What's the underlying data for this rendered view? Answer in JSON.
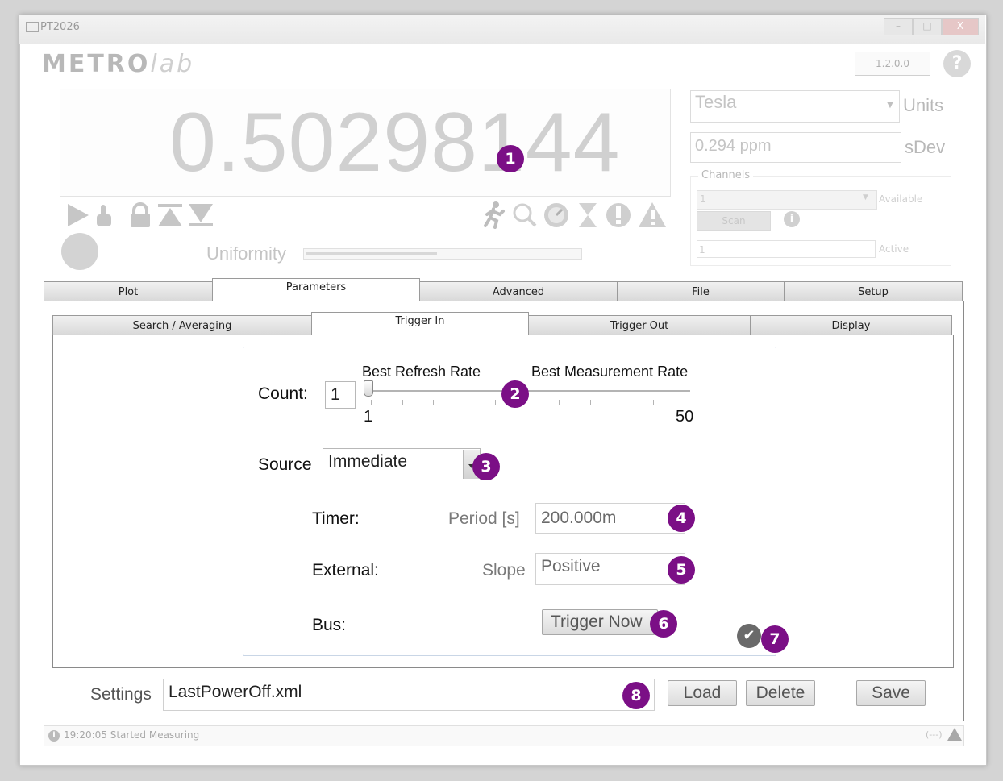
{
  "window": {
    "title": "PT2026",
    "min_label": "–",
    "max_label": "□",
    "close_label": "X"
  },
  "header": {
    "logo_main": "METRO",
    "logo_italic": "lab",
    "version": "1.2.0.0",
    "help_label": "?"
  },
  "readout": {
    "value": "0.50298144"
  },
  "toolbar_icons": [
    "play-icon",
    "touch-icon",
    "lock-icon",
    "arrow-up-icon",
    "arrow-down-icon",
    "running-icon",
    "search-icon",
    "gauge-icon",
    "hourglass-icon",
    "exclamation-icon",
    "warning-icon"
  ],
  "units": {
    "value": "Tesla",
    "label": "Units"
  },
  "sdev": {
    "value": "0.294 ppm",
    "label": "sDev"
  },
  "channels": {
    "group_label": "Channels",
    "available_value": "1",
    "available_label": "Available",
    "scan_label": "Scan",
    "info_label": "i",
    "active_value": "1",
    "active_label": "Active"
  },
  "uniformity": {
    "label": "Uniformity",
    "level": 0.48
  },
  "tabs_main": [
    "Plot",
    "Parameters",
    "Advanced",
    "File",
    "Setup"
  ],
  "tabs_main_active": "Parameters",
  "tabs_sub": [
    "Search / Averaging",
    "Trigger In",
    "Trigger Out",
    "Display"
  ],
  "tabs_sub_active": "Trigger In",
  "trigger_in": {
    "count_label": "Count:",
    "count_value": "1",
    "slider_left_label": "Best Refresh Rate",
    "slider_right_label": "Best Measurement Rate",
    "slider_min": "1",
    "slider_max": "50",
    "slider_value": 1,
    "source_label": "Source",
    "source_value": "Immediate",
    "timer_label": "Timer:",
    "period_label": "Period [s]",
    "period_value": "200.000m",
    "external_label": "External:",
    "slope_label": "Slope",
    "slope_value": "Positive",
    "bus_label": "Bus:",
    "trigger_now_label": "Trigger Now"
  },
  "settings": {
    "label": "Settings",
    "value": "LastPowerOff.xml",
    "load_label": "Load",
    "delete_label": "Delete",
    "save_label": "Save"
  },
  "callouts": [
    "1",
    "2",
    "3",
    "4",
    "5",
    "6",
    "7",
    "8"
  ],
  "status": {
    "icon_label": "i",
    "message": "19:20:05 Started Measuring",
    "right_indicator": "(---)"
  },
  "colors": {
    "callout": "#7b0f86",
    "disabled_text": "#c4c4c4"
  }
}
